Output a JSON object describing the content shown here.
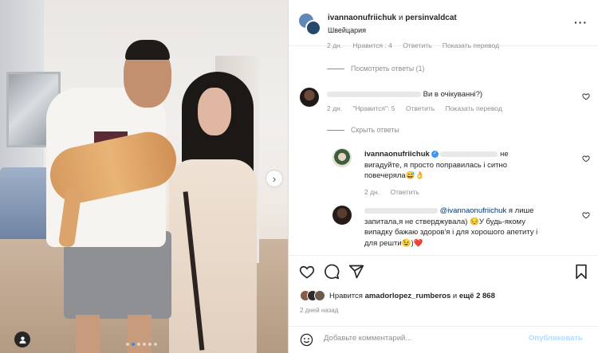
{
  "header": {
    "user1": "ivannaonufriichuk",
    "joiner": "и",
    "user2": "persinvaldcat",
    "location": "Швейцария",
    "more": "···"
  },
  "comments": {
    "top_meta": {
      "time": "2 дн.",
      "likes": "Нравится : 4",
      "reply": "Ответить",
      "translate": "Показать перевод"
    },
    "view_replies": "Посмотреть ответы (1)",
    "comment1": {
      "text": "Ви в очікуванні?)",
      "time": "2 дн.",
      "likes": "\"Нравится\": 5",
      "reply": "Ответить",
      "translate": "Показать перевод"
    },
    "hide_replies": "Скрыть ответы",
    "reply1": {
      "username": "ivannaonufriichuk",
      "text_a": "не",
      "text_b": "вигадуйте, я просто поправилась і ситно",
      "text_c": "повечеряла😅👌",
      "time": "2 дн.",
      "reply": "Ответить"
    },
    "reply2": {
      "mention": "@ivannaonufriichuk",
      "text_a": "я лише",
      "text_b": "запитала,я не стверджувала) 😔У будь-якому",
      "text_c": "випадку бажаю здоров'я і для хорошого апетиту і",
      "text_d": "для решти😉)❤️"
    }
  },
  "actions": {
    "likes_prefix": "Нравится",
    "likes_user": "amadorlopez_rumberos",
    "likes_joiner": "и",
    "likes_rest": "ещё 2 868",
    "time": "2 дней назад",
    "comment_placeholder": "Добавьте комментарий...",
    "publish": "Опубликовать"
  },
  "photo": {
    "next_glyph": "›",
    "dots": 6,
    "active_dot": 1
  },
  "colors": {
    "accent_blue": "#3897f0",
    "publish_disabled": "#b3dbff",
    "heart_red": "#ed4956",
    "muted": "#8e8e8e"
  }
}
